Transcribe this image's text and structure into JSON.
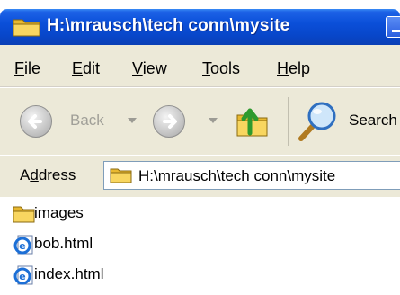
{
  "window": {
    "title": "H:\\mrausch\\tech conn\\mysite"
  },
  "menu": {
    "items": [
      {
        "key": "F",
        "rest": "ile"
      },
      {
        "key": "E",
        "rest": "dit"
      },
      {
        "key": "V",
        "rest": "iew"
      },
      {
        "key": "T",
        "rest": "ools"
      },
      {
        "key": "H",
        "rest": "elp"
      }
    ]
  },
  "toolbar": {
    "back_label": "Back",
    "search_label": "Search"
  },
  "address": {
    "label_pre": "A",
    "label_key": "d",
    "label_post": "dress",
    "value": "H:\\mrausch\\tech conn\\mysite"
  },
  "files": [
    {
      "name": "images",
      "icon": "folder-icon"
    },
    {
      "name": "bob.html",
      "icon": "ie-document-icon"
    },
    {
      "name": "index.html",
      "icon": "ie-document-icon"
    }
  ],
  "colors": {
    "titlebar": "#0a4fd9",
    "chrome": "#ece9d8",
    "folder": "#f5c84a"
  }
}
